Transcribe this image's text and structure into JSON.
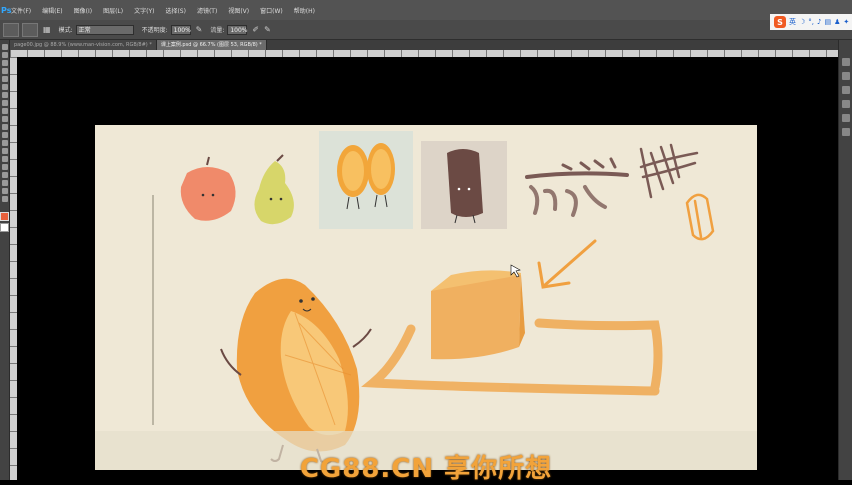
{
  "menubar": {
    "app_logo": "Ps",
    "items": [
      "文件(F)",
      "编辑(E)",
      "图像(I)",
      "图层(L)",
      "文字(Y)",
      "选择(S)",
      "滤镜(T)",
      "视图(V)",
      "窗口(W)",
      "帮助(H)"
    ]
  },
  "ime": {
    "logo": "S",
    "label": "英"
  },
  "options": {
    "mode_label": "模式:",
    "mode_value": "正常",
    "opacity_label": "不透明度:",
    "opacity_value": "100%",
    "flow_label": "流量:",
    "flow_value": "100%"
  },
  "tabs": [
    {
      "label": "page00.jpg @ 88.9% (www.man-vision.com, RGB/8#) *",
      "active": false
    },
    {
      "label": "课上案例.psd @ 66.7% (图层 53, RGB/8) *",
      "active": true
    }
  ],
  "canvas": {
    "colors": {
      "background": "#efe8d6",
      "orange": "#f0a040",
      "brown": "#6b4a44"
    }
  },
  "watermark": "CG88.CN 享你所想"
}
